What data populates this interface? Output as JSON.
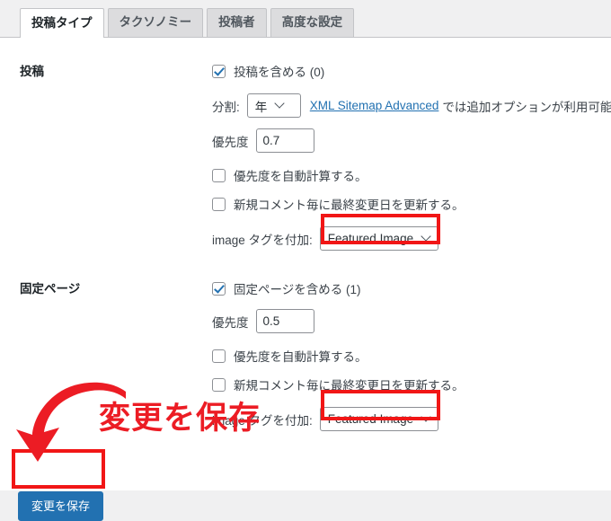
{
  "tabs": [
    {
      "label": "投稿タイプ",
      "active": true
    },
    {
      "label": "タクソノミー",
      "active": false
    },
    {
      "label": "投稿者",
      "active": false
    },
    {
      "label": "高度な設定",
      "active": false
    }
  ],
  "sections": {
    "posts": {
      "label": "投稿",
      "include_checkbox": {
        "label": "投稿を含める (0)",
        "checked": true
      },
      "split": {
        "label": "分割:",
        "value": "年"
      },
      "advanced_link": {
        "text": "XML Sitemap Advanced",
        "suffix": "では追加オプションが利用可能。"
      },
      "priority": {
        "label": "優先度",
        "value": "0.7"
      },
      "auto_priority": {
        "label": "優先度を自動計算する。",
        "checked": false
      },
      "update_on_comment": {
        "label": "新規コメント毎に最終変更日を更新する。",
        "checked": false
      },
      "image_tag": {
        "label": "image タグを付加:",
        "value": "Featured Image"
      }
    },
    "pages": {
      "label": "固定ページ",
      "include_checkbox": {
        "label": "固定ページを含める (1)",
        "checked": true
      },
      "priority": {
        "label": "優先度",
        "value": "0.5"
      },
      "auto_priority": {
        "label": "優先度を自動計算する。",
        "checked": false
      },
      "update_on_comment": {
        "label": "新規コメント毎に最終変更日を更新する。",
        "checked": false
      },
      "image_tag": {
        "label": "image タグを付加:",
        "value": "Featured Image"
      }
    }
  },
  "save_button": {
    "label": "変更を保存"
  },
  "annotation": {
    "caption": "変更を保存",
    "arrow": "curved-down-left-arrow",
    "color": "#ec1c24",
    "highlight_color": "#f11616"
  }
}
